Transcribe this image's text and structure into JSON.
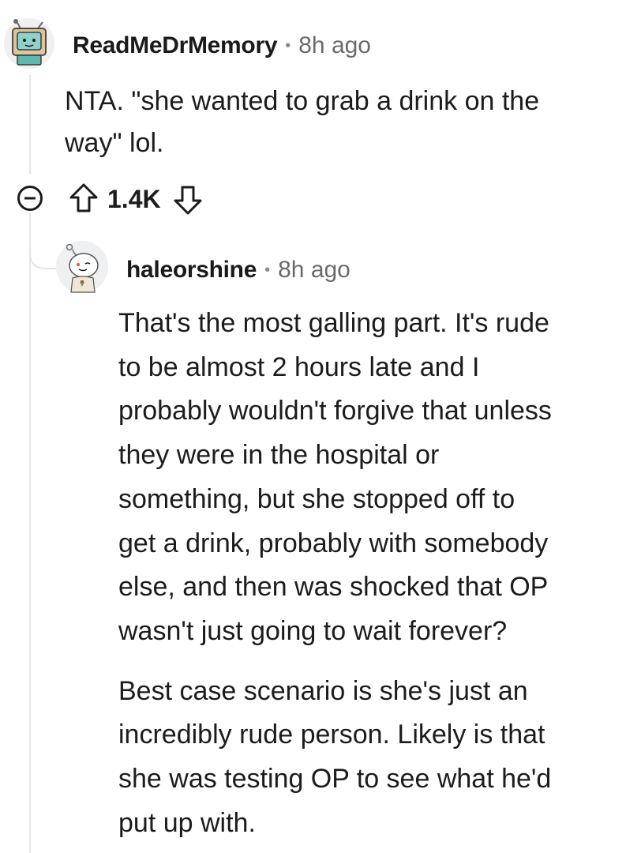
{
  "comment": {
    "author": "ReadMeDrMemory",
    "separator": "•",
    "time": "8h ago",
    "text_lines": [
      "NTA. \"she wanted to grab a drink on the",
      "way\" lol."
    ],
    "votes": "1.4K",
    "icons": {
      "collapse": "collapse-icon",
      "upvote": "upvote-arrow-icon",
      "downvote": "downvote-arrow-icon"
    }
  },
  "reply": {
    "author": "haleorshine",
    "separator": "•",
    "time": "8h ago",
    "paragraph1_lines": [
      "That's the most galling part. It's rude",
      "to be almost 2 hours late and I",
      "probably wouldn't forgive that unless",
      "they were in the hospital or",
      "something, but she stopped off to",
      "get a drink, probably with somebody",
      "else, and then was shocked that OP",
      "wasn't just going to wait forever?"
    ],
    "paragraph2_lines": [
      "Best case scenario is she's just an",
      "incredibly rude person. Likely is that",
      "she was testing OP to see what he'd",
      "put up with."
    ]
  },
  "colors": {
    "text": "#1c1c1c",
    "meta": "#6a6a6a",
    "thread": "#e4e4e4"
  }
}
